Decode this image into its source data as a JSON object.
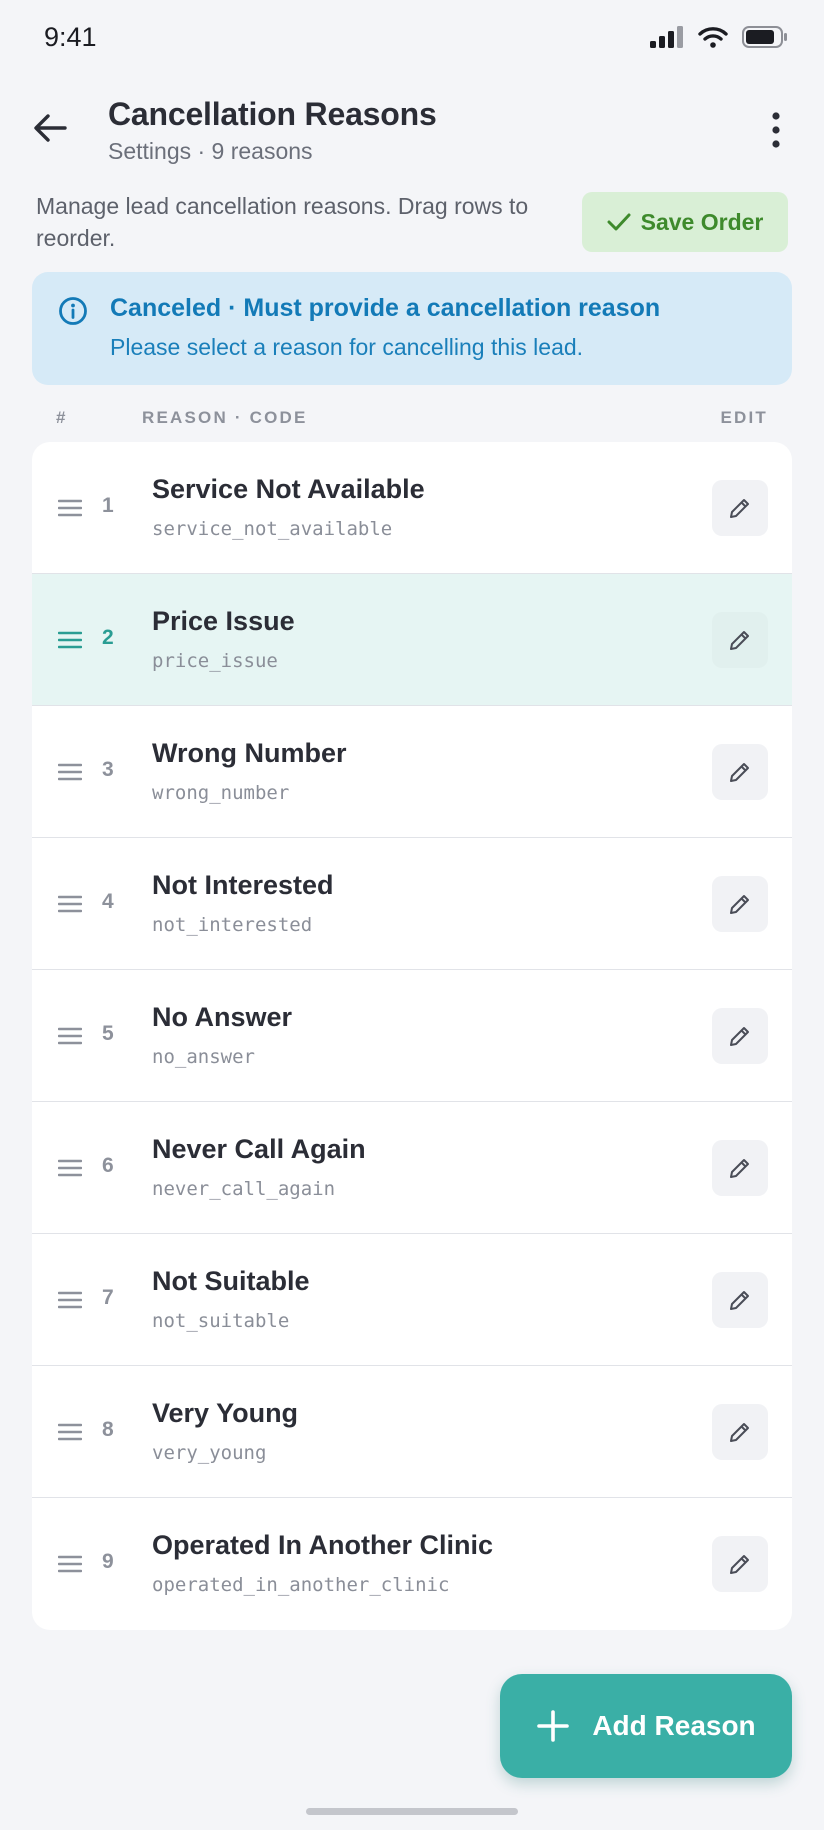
{
  "status": {
    "time": "9:41",
    "icons": [
      "signal-icon",
      "wifi-icon",
      "battery-icon"
    ]
  },
  "header": {
    "title": "Cancellation Reasons",
    "subtitle": "Settings · 9 reasons",
    "back_icon": "arrow-left-icon",
    "more_icon": "more-vertical-icon"
  },
  "description": "Manage lead cancellation reasons. Drag rows to reorder.",
  "save_button": {
    "label": "Save Order",
    "icon": "check-icon"
  },
  "banner": {
    "icon": "info-icon",
    "title": "Canceled · Must provide a cancellation reason",
    "text": "Please select a reason for cancelling this lead."
  },
  "columns": {
    "num": "#",
    "reason": "REASON · CODE",
    "edit": "EDIT"
  },
  "reasons": [
    {
      "num": "1",
      "name": "Service Not Available",
      "code": "service_not_available",
      "active": false
    },
    {
      "num": "2",
      "name": "Price Issue",
      "code": "price_issue",
      "active": true
    },
    {
      "num": "3",
      "name": "Wrong Number",
      "code": "wrong_number",
      "active": false
    },
    {
      "num": "4",
      "name": "Not Interested",
      "code": "not_interested",
      "active": false
    },
    {
      "num": "5",
      "name": "No Answer",
      "code": "no_answer",
      "active": false
    },
    {
      "num": "6",
      "name": "Never Call Again",
      "code": "never_call_again",
      "active": false
    },
    {
      "num": "7",
      "name": "Not Suitable",
      "code": "not_suitable",
      "active": false
    },
    {
      "num": "8",
      "name": "Very Young",
      "code": "very_young",
      "active": false
    },
    {
      "num": "9",
      "name": "Operated In Another Clinic",
      "code": "operated_in_another_clinic",
      "active": false
    }
  ],
  "fab": {
    "label": "Add Reason",
    "icon": "plus-icon"
  },
  "colors": {
    "accent": "#3aafa6",
    "save_bg": "#d9efd6",
    "save_text": "#3e8a2c",
    "banner_bg": "#d6eaf7",
    "banner_text": "#137ab7",
    "active_row_bg": "#e6f5f3"
  }
}
